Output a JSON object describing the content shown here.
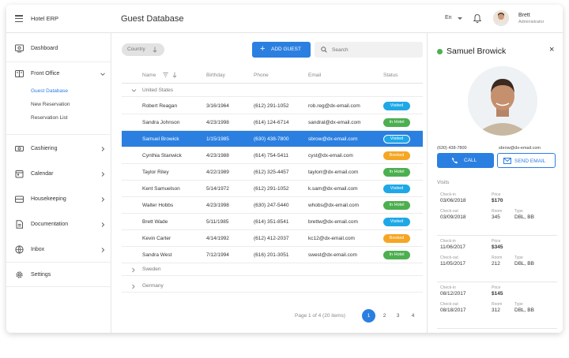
{
  "app": {
    "title": "Hotel ERP",
    "page_title": "Guest Database"
  },
  "header": {
    "language": "En",
    "user_name": "Brett",
    "user_role": "Administrator"
  },
  "sidebar": {
    "items": [
      {
        "label": "Dashboard",
        "icon": "dashboard-icon"
      },
      {
        "label": "Front Office",
        "icon": "front-office-icon"
      },
      {
        "label": "Cashiering",
        "icon": "cashiering-icon"
      },
      {
        "label": "Calendar",
        "icon": "calendar-icon"
      },
      {
        "label": "Housekeeping",
        "icon": "housekeeping-icon"
      },
      {
        "label": "Documentation",
        "icon": "documentation-icon"
      },
      {
        "label": "Inbox",
        "icon": "inbox-icon"
      },
      {
        "label": "Settings",
        "icon": "gear-icon"
      }
    ],
    "front_office_sub": [
      "Guest Database",
      "New Reservation",
      "Reservation List"
    ]
  },
  "toolbar": {
    "country_chip": "Country",
    "add_guest": "ADD GUEST",
    "search_placeholder": "Search"
  },
  "grid": {
    "columns": [
      "Name",
      "Birthday",
      "Phone",
      "Email",
      "Status"
    ],
    "groups": [
      "United States",
      "Sweden",
      "Germany"
    ],
    "rows": [
      {
        "name": "Robert Reagan",
        "birthday": "3/16/1964",
        "phone": "(612) 291-1052",
        "email": "rob.reg@dx-email.com",
        "status": "Visited"
      },
      {
        "name": "Sandra Johnson",
        "birthday": "4/23/1998",
        "phone": "(614) 124-6714",
        "email": "sandral@dx-email.com",
        "status": "In Hotel"
      },
      {
        "name": "Samuel Browick",
        "birthday": "1/15/1985",
        "phone": "(630) 438-7800",
        "email": "sbrow@dx-email.com",
        "status": "Visited"
      },
      {
        "name": "Cynthia Stanwick",
        "birthday": "4/23/1988",
        "phone": "(614) 754-5411",
        "email": "cyst@dx-email.com",
        "status": "Booked"
      },
      {
        "name": "Taylor Riley",
        "birthday": "4/22/1989",
        "phone": "(612) 325-4457",
        "email": "taylorr@dx-email.com",
        "status": "In Hotel"
      },
      {
        "name": "Kent Samuelson",
        "birthday": "5/14/1972",
        "phone": "(612) 291-1052",
        "email": "k.sam@dx-email.com",
        "status": "Visited"
      },
      {
        "name": "Walter Hobbs",
        "birthday": "4/23/1998",
        "phone": "(630) 247-5440",
        "email": "whobs@dx-email.com",
        "status": "In Hotel"
      },
      {
        "name": "Brett Wade",
        "birthday": "5/11/1985",
        "phone": "(614) 351-8541",
        "email": "brettw@dx-email.com",
        "status": "Visited"
      },
      {
        "name": "Kevin Carter",
        "birthday": "4/14/1992",
        "phone": "(612) 412-2037",
        "email": "kc12@dx-email.com",
        "status": "Booked"
      },
      {
        "name": "Sandra West",
        "birthday": "7/12/1994",
        "phone": "(616) 201-3051",
        "email": "swest@dx-email.com",
        "status": "In Hotel"
      }
    ],
    "selected_row": 2
  },
  "status_colors": {
    "Visited": "#1fa8e6",
    "In Hotel": "#4caf50",
    "Booked": "#f5a623"
  },
  "pager": {
    "info": "Page 1 of 4 (20 items)",
    "pages": [
      "1",
      "2",
      "3",
      "4"
    ],
    "current": "1"
  },
  "panel": {
    "name": "Samuel Browick",
    "phone": "(630) 438-7800",
    "email": "sbrow@dx-email.com",
    "call_label": "CALL",
    "email_label": "SEND EMAIL",
    "visits_title": "Visits",
    "labels": {
      "check_in": "Check-in",
      "check_out": "Check-out",
      "price": "Price",
      "room": "Room",
      "type": "Type"
    },
    "visits": [
      {
        "check_in": "03/06/2018",
        "check_out": "03/09/2018",
        "price": "$170",
        "room": "345",
        "type": "DBL, BB"
      },
      {
        "check_in": "11/06/2017",
        "check_out": "11/05/2017",
        "price": "$345",
        "room": "212",
        "type": "DBL, BB"
      },
      {
        "check_in": "08/12/2017",
        "check_out": "08/18/2017",
        "price": "$145",
        "room": "312",
        "type": "DBL, BB"
      }
    ]
  }
}
